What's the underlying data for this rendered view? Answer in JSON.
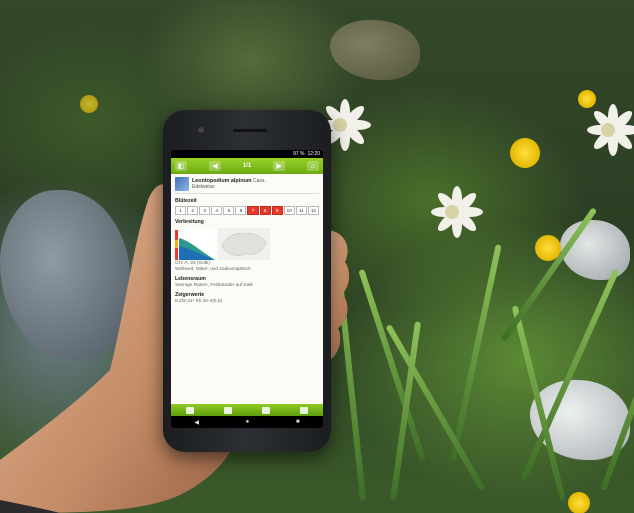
{
  "phone_screen": {
    "status": {
      "battery": "97 %",
      "time": "12:20"
    },
    "toolbar": {
      "pager": "1/1"
    },
    "species": {
      "name": "Leontopodium alpinum",
      "author": "Cass.",
      "common": "Edelweiss"
    },
    "sections": {
      "bloom_title": "Blütezeit",
      "distribution_title": "Verbreitung",
      "habitat_title": "Lebensraum",
      "indicator_title": "Zeigerwerte"
    },
    "bloom_months": [
      "1",
      "2",
      "3",
      "4",
      "5",
      "6",
      "7",
      "8",
      "9",
      "10",
      "11",
      "12"
    ],
    "bloom_active": [
      7,
      8,
      9
    ],
    "distribution_lines": [
      "CH: A, 25 (Golk)",
      "Weltweit: Mittel- und südeuropäisch"
    ],
    "habitat_text": "Steinige Rasen, Felsbänder auf Kalk",
    "indicator_text": "8.2f2-41* Kk 2e-4(6.5)"
  },
  "colors": {
    "toolbar_green": "#7dbb1a",
    "bloom_red": "#e53a2a"
  },
  "icons": [
    "back-icon",
    "prev-arrow-icon",
    "next-arrow-icon",
    "home-icon",
    "search-icon",
    "list-icon",
    "flower-icon",
    "info-icon",
    "nav-back-icon",
    "nav-home-icon",
    "nav-recent-icon"
  ]
}
